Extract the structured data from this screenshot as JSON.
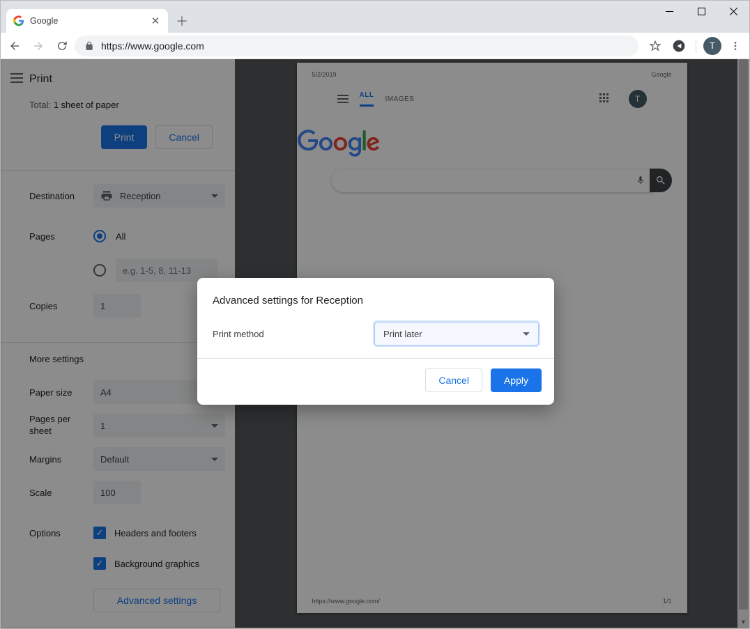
{
  "browser": {
    "tab_title": "Google",
    "url": "https://www.google.com",
    "avatar_letter": "T"
  },
  "print": {
    "title": "Print",
    "total_prefix": "Total: ",
    "total_value": "1 sheet of paper",
    "print_button": "Print",
    "cancel_button": "Cancel",
    "destination_label": "Destination",
    "destination_value": "Reception",
    "pages_label": "Pages",
    "pages_all": "All",
    "pages_custom_placeholder": "e.g. 1-5, 8, 11-13",
    "copies_label": "Copies",
    "copies_value": "1",
    "more_settings": "More settings",
    "paper_size_label": "Paper size",
    "paper_size_value": "A4",
    "pps_label": "Pages per sheet",
    "pps_value": "1",
    "margins_label": "Margins",
    "margins_value": "Default",
    "scale_label": "Scale",
    "scale_value": "100",
    "options_label": "Options",
    "opt_headers": "Headers and footers",
    "opt_bg": "Background graphics",
    "advanced_button": "Advanced settings"
  },
  "preview": {
    "date": "5/2/2019",
    "title": "Google",
    "footer_url": "https://www.google.com/",
    "page_num": "1/1",
    "tab_all": "ALL",
    "tab_images": "IMAGES",
    "avatar_letter": "T"
  },
  "modal": {
    "title": "Advanced settings for Reception",
    "print_method_label": "Print method",
    "print_method_value": "Print later",
    "cancel": "Cancel",
    "apply": "Apply"
  }
}
